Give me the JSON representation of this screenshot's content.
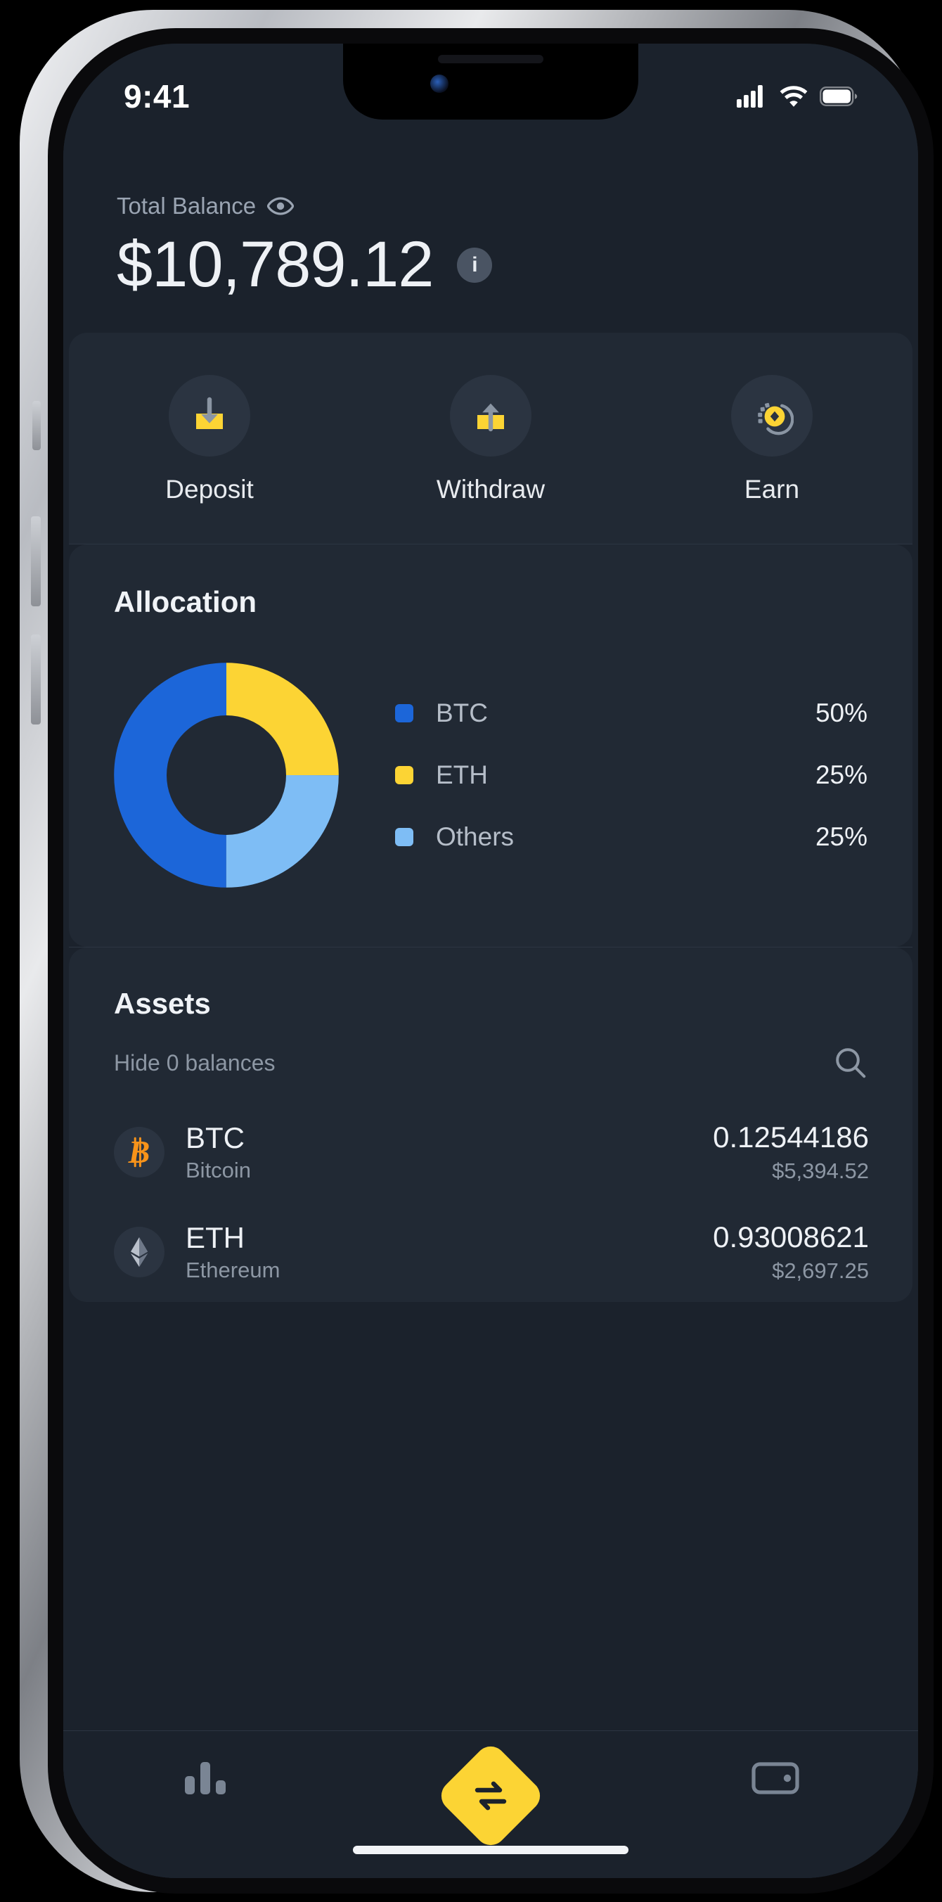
{
  "status_bar": {
    "time": "9:41",
    "icons": [
      "cellular-signal-icon",
      "wifi-icon",
      "battery-icon"
    ]
  },
  "balance": {
    "label": "Total Balance",
    "eye_icon": "eye-icon",
    "amount": "$10,789.12",
    "info_icon": "i"
  },
  "quick_actions": [
    {
      "label": "Deposit",
      "icon": "deposit-icon"
    },
    {
      "label": "Withdraw",
      "icon": "withdraw-icon"
    },
    {
      "label": "Earn",
      "icon": "earn-coin-icon"
    }
  ],
  "allocation": {
    "title": "Allocation"
  },
  "chart_data": {
    "type": "pie",
    "title": "Allocation",
    "legend_position": "right",
    "donut": true,
    "inner_radius_ratio": 0.62,
    "start_angle_deg": 0,
    "direction": "clockwise",
    "categories": [
      "ETH",
      "Others",
      "BTC"
    ],
    "values": [
      25,
      25,
      50
    ],
    "labels": [
      "25%",
      "25%",
      "50%"
    ],
    "colors": [
      "#FCD434",
      "#7EBDF5",
      "#1C66D9"
    ],
    "legend_order": [
      {
        "name": "BTC",
        "value": 50,
        "label": "50%",
        "color": "#1C66D9"
      },
      {
        "name": "ETH",
        "value": 25,
        "label": "25%",
        "color": "#FCD434"
      },
      {
        "name": "Others",
        "value": 25,
        "label": "25%",
        "color": "#7EBDF5"
      }
    ],
    "units": "percent"
  },
  "assets": {
    "title": "Assets",
    "hide_balances_label": "Hide 0 balances",
    "search_icon": "search-icon",
    "rows": [
      {
        "symbol": "BTC",
        "name": "Bitcoin",
        "quantity": "0.12544186",
        "usd_value": "$5,394.52",
        "icon": "bitcoin-icon",
        "icon_color": "#F7931A"
      },
      {
        "symbol": "ETH",
        "name": "Ethereum",
        "quantity": "0.93008621",
        "usd_value": "$2,697.25",
        "icon": "ethereum-icon",
        "icon_color": "#8A93A3"
      }
    ]
  },
  "tabbar": {
    "items": [
      {
        "name": "markets",
        "icon": "bar-chart-icon"
      },
      {
        "name": "swap",
        "icon": "swap-arrows-icon"
      },
      {
        "name": "wallet",
        "icon": "wallet-icon"
      }
    ]
  },
  "colors": {
    "accent_yellow": "#FCD434",
    "btc_blue": "#1C66D9",
    "others_blue": "#7EBDF5",
    "bitcoin_orange": "#F7931A",
    "background": "#1b222c",
    "card": "#212934"
  }
}
